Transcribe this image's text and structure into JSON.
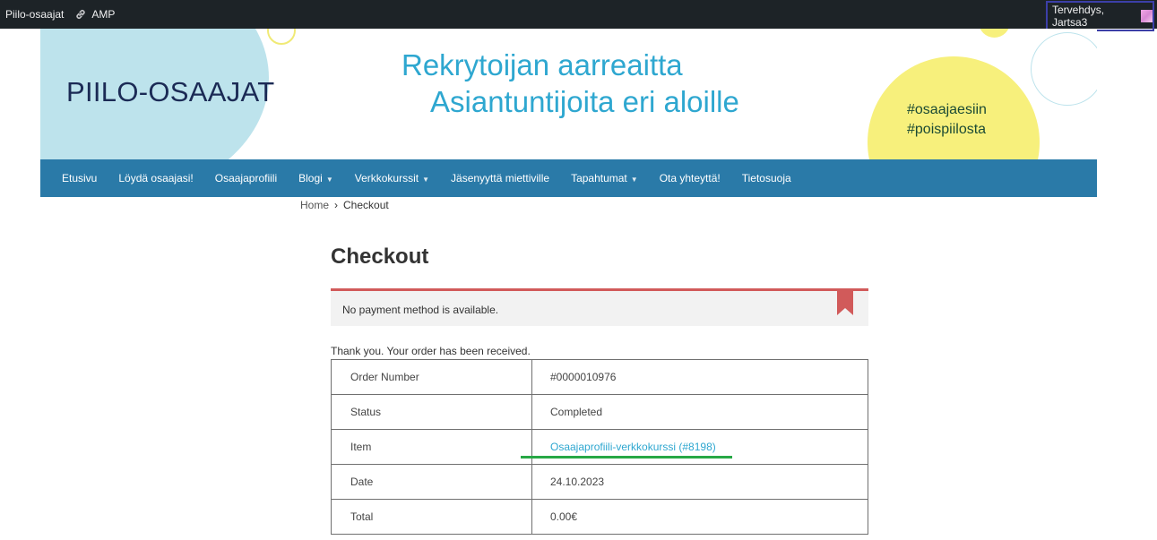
{
  "admin_bar": {
    "site_name": "Piilo-osaajat",
    "amp_label": "AMP",
    "greeting": "Tervehdys, Jartsa3"
  },
  "header": {
    "logo": "PIILO-OSAAJAT",
    "tagline_line1": "Rekrytoijan aarreaitta",
    "tagline_line2": "Asiantuntijoita eri aloille",
    "hashtag1": "#osaajaesiin",
    "hashtag2": "#poispiilosta"
  },
  "nav": {
    "items": [
      {
        "label": "Etusivu"
      },
      {
        "label": "Löydä osaajasi!"
      },
      {
        "label": "Osaajaprofiili"
      },
      {
        "label": "Blogi"
      },
      {
        "label": "Verkkokurssit"
      },
      {
        "label": "Jäsenyyttä miettiville"
      },
      {
        "label": "Tapahtumat"
      },
      {
        "label": "Ota yhteyttä!"
      },
      {
        "label": "Tietosuoja"
      }
    ]
  },
  "breadcrumb": {
    "home": "Home",
    "separator": "›",
    "current": "Checkout"
  },
  "page_title": "Checkout",
  "notice": {
    "message": "No payment method is available."
  },
  "order": {
    "thanks": "Thank you. Your order has been received.",
    "rows": [
      {
        "label": "Order Number",
        "value": "#0000010976"
      },
      {
        "label": "Status",
        "value": "Completed"
      },
      {
        "label": "Item",
        "value": "Osaajaprofiili-verkkokurssi (#8198)"
      },
      {
        "label": "Date",
        "value": "24.10.2023"
      },
      {
        "label": "Total",
        "value": "0.00€"
      }
    ]
  },
  "colors": {
    "admin_bar": "#1d2327",
    "nav": "#2a7aa8",
    "accent_blue": "#2ea7d0",
    "notice_red": "#d15a5a",
    "highlight_green": "#27a845",
    "highlight_box": "#3c3fa8"
  }
}
